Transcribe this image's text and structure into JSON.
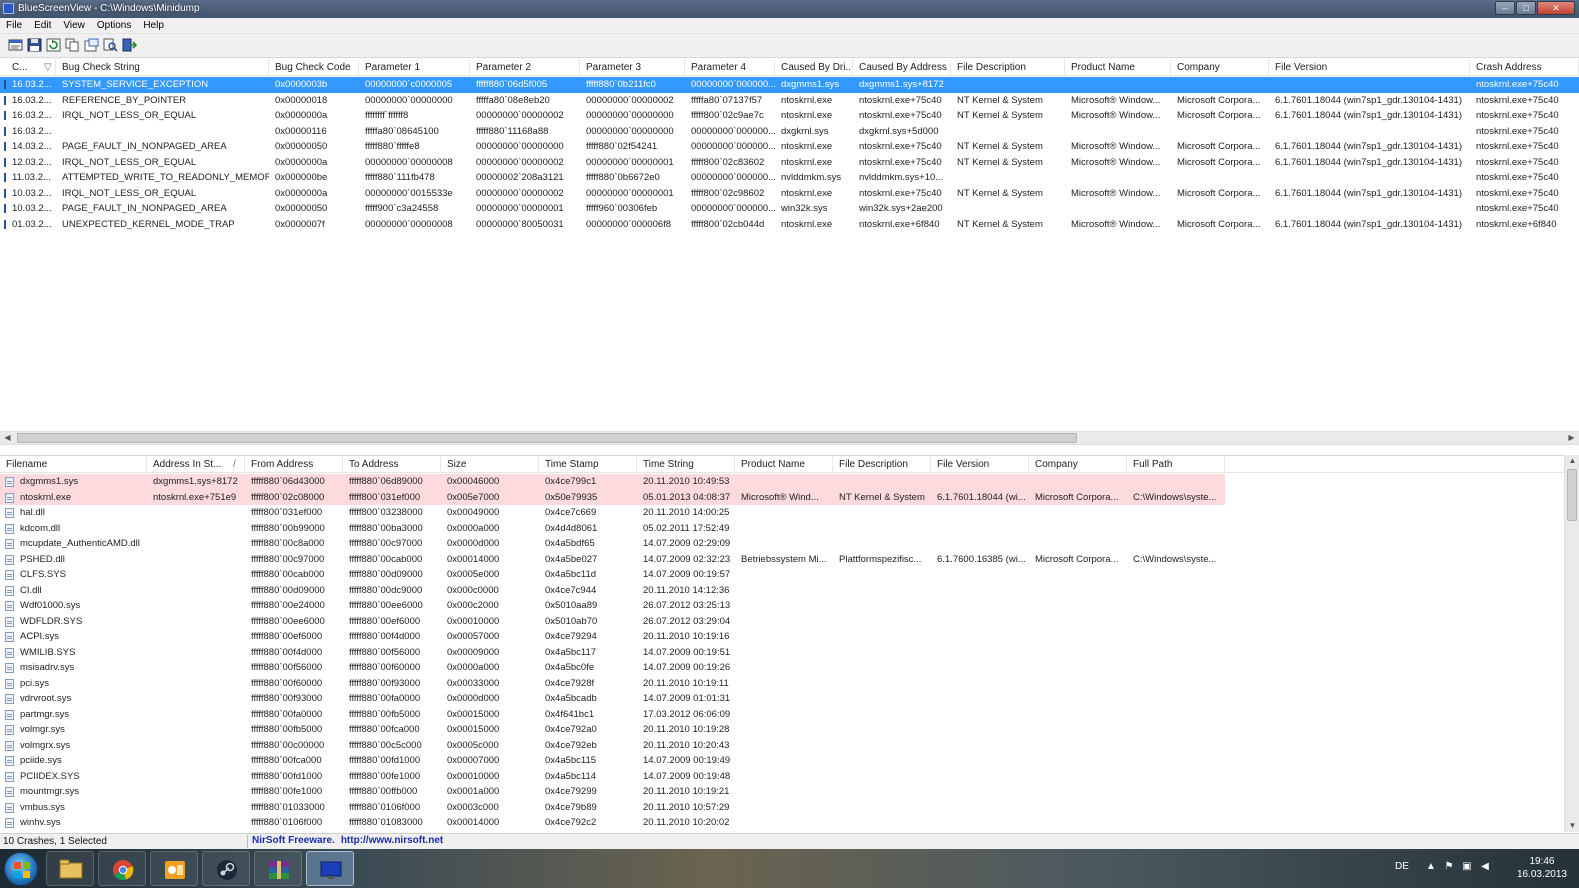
{
  "window": {
    "title": "BlueScreenView  -  C:\\Windows\\Minidump",
    "minimize": "–",
    "maximize": "□",
    "close": "✕"
  },
  "menu": [
    "File",
    "Edit",
    "View",
    "Options",
    "Help"
  ],
  "toolbar": {
    "icons": [
      "properties-icon",
      "save-icon",
      "refresh-icon",
      "copy-icon",
      "html-report-icon",
      "find-icon",
      "exit-icon"
    ]
  },
  "crash_list": {
    "columns": [
      "C...",
      "Bug Check String",
      "Bug Check Code",
      "Parameter 1",
      "Parameter 2",
      "Parameter 3",
      "Parameter 4",
      "Caused By Dri...",
      "Caused By Address",
      "File Description",
      "Product Name",
      "Company",
      "File Version",
      "Crash Address"
    ],
    "sort_indicator": "▽",
    "rows": [
      [
        "16.03.2...",
        "SYSTEM_SERVICE_EXCEPTION",
        "0x0000003b",
        "00000000`c0000005",
        "fffff880`06d5f005",
        "fffff880`0b211fc0",
        "00000000`000000...",
        "dxgmms1.sys",
        "dxgmms1.sys+8172",
        "",
        "",
        "",
        "",
        "ntoskrnl.exe+75c40"
      ],
      [
        "16.03.2...",
        "REFERENCE_BY_POINTER",
        "0x00000018",
        "00000000`00000000",
        "fffffa80`08e8eb20",
        "00000000`00000002",
        "fffffa80`07137f57",
        "ntoskrnl.exe",
        "ntoskrnl.exe+75c40",
        "NT Kernel & System",
        "Microsoft® Window...",
        "Microsoft Corpora...",
        "6.1.7601.18044 (win7sp1_gdr.130104-1431)",
        "ntoskrnl.exe+75c40"
      ],
      [
        "16.03.2...",
        "IRQL_NOT_LESS_OR_EQUAL",
        "0x0000000a",
        "ffffffff`ffffff8",
        "00000000`00000002",
        "00000000`00000000",
        "fffff800`02c9ae7c",
        "ntoskrnl.exe",
        "ntoskrnl.exe+75c40",
        "NT Kernel & System",
        "Microsoft® Window...",
        "Microsoft Corpora...",
        "6.1.7601.18044 (win7sp1_gdr.130104-1431)",
        "ntoskrnl.exe+75c40"
      ],
      [
        "16.03.2...",
        "",
        "0x00000116",
        "fffffa80`08645100",
        "fffff880`11168a88",
        "00000000`00000000",
        "00000000`000000...",
        "dxgkrnl.sys",
        "dxgkrnl.sys+5d000",
        "",
        "",
        "",
        "",
        "ntoskrnl.exe+75c40"
      ],
      [
        "14.03.2...",
        "PAGE_FAULT_IN_NONPAGED_AREA",
        "0x00000050",
        "fffff880`fffffe8",
        "00000000`00000000",
        "fffff880`02f54241",
        "00000000`000000...",
        "ntoskrnl.exe",
        "ntoskrnl.exe+75c40",
        "NT Kernel & System",
        "Microsoft® Window...",
        "Microsoft Corpora...",
        "6.1.7601.18044 (win7sp1_gdr.130104-1431)",
        "ntoskrnl.exe+75c40"
      ],
      [
        "12.03.2...",
        "IRQL_NOT_LESS_OR_EQUAL",
        "0x0000000a",
        "00000000`00000008",
        "00000000`00000002",
        "00000000`00000001",
        "fffff800`02c83602",
        "ntoskrnl.exe",
        "ntoskrnl.exe+75c40",
        "NT Kernel & System",
        "Microsoft® Window...",
        "Microsoft Corpora...",
        "6.1.7601.18044 (win7sp1_gdr.130104-1431)",
        "ntoskrnl.exe+75c40"
      ],
      [
        "11.03.2...",
        "ATTEMPTED_WRITE_TO_READONLY_MEMORY",
        "0x000000be",
        "fffff880`111fb478",
        "00000002`208a3121",
        "fffff880`0b6672e0",
        "00000000`000000...",
        "nvlddmkm.sys",
        "nvlddmkm.sys+10...",
        "",
        "",
        "",
        "",
        "ntoskrnl.exe+75c40"
      ],
      [
        "10.03.2...",
        "IRQL_NOT_LESS_OR_EQUAL",
        "0x0000000a",
        "00000000`0015533e",
        "00000000`00000002",
        "00000000`00000001",
        "fffff800`02c98602",
        "ntoskrnl.exe",
        "ntoskrnl.exe+75c40",
        "NT Kernel & System",
        "Microsoft® Window...",
        "Microsoft Corpora...",
        "6.1.7601.18044 (win7sp1_gdr.130104-1431)",
        "ntoskrnl.exe+75c40"
      ],
      [
        "10.03.2...",
        "PAGE_FAULT_IN_NONPAGED_AREA",
        "0x00000050",
        "fffff900`c3a24558",
        "00000000`00000001",
        "fffff960`00306feb",
        "00000000`000000...",
        "win32k.sys",
        "win32k.sys+2ae200",
        "",
        "",
        "",
        "",
        "ntoskrnl.exe+75c40"
      ],
      [
        "01.03.2...",
        "UNEXPECTED_KERNEL_MODE_TRAP",
        "0x0000007f",
        "00000000`00000008",
        "00000000`80050031",
        "00000000`000006f8",
        "fffff800`02cb044d",
        "ntoskrnl.exe",
        "ntoskrnl.exe+6f840",
        "NT Kernel & System",
        "Microsoft® Window...",
        "Microsoft Corpora...",
        "6.1.7601.18044 (win7sp1_gdr.130104-1431)",
        "ntoskrnl.exe+6f840"
      ]
    ],
    "selected_row": 0
  },
  "driver_list": {
    "columns": [
      "Filename",
      "Address In St...",
      "From Address",
      "To Address",
      "Size",
      "Time Stamp",
      "Time String",
      "Product Name",
      "File Description",
      "File Version",
      "Company",
      "Full Path"
    ],
    "sort_indicator": "/",
    "rows": [
      [
        "dxgmms1.sys",
        "dxgmms1.sys+8172",
        "fffff880`06d43000",
        "fffff880`06d89000",
        "0x00046000",
        "0x4ce799c1",
        "20.11.2010 10:49:53",
        "",
        "",
        "",
        "",
        ""
      ],
      [
        "ntoskrnl.exe",
        "ntoskrnl.exe+751e9",
        "fffff800`02c08000",
        "fffff800`031ef000",
        "0x005e7000",
        "0x50e79935",
        "05.01.2013 04:08:37",
        "Microsoft® Wind...",
        "NT Kernel & System",
        "6.1.7601.18044 (wi...",
        "Microsoft Corpora...",
        "C:\\Windows\\syste..."
      ],
      [
        "hal.dll",
        "",
        "fffff800`031ef000",
        "fffff800`03238000",
        "0x00049000",
        "0x4ce7c669",
        "20.11.2010 14:00:25",
        "",
        "",
        "",
        "",
        ""
      ],
      [
        "kdcom.dll",
        "",
        "fffff880`00b99000",
        "fffff880`00ba3000",
        "0x0000a000",
        "0x4d4d8061",
        "05.02.2011 17:52:49",
        "",
        "",
        "",
        "",
        ""
      ],
      [
        "mcupdate_AuthenticAMD.dll",
        "",
        "fffff880`00c8a000",
        "fffff880`00c97000",
        "0x0000d000",
        "0x4a5bdf65",
        "14.07.2009 02:29:09",
        "",
        "",
        "",
        "",
        ""
      ],
      [
        "PSHED.dll",
        "",
        "fffff880`00c97000",
        "fffff880`00cab000",
        "0x00014000",
        "0x4a5be027",
        "14.07.2009 02:32:23",
        "Betriebssystem Mi...",
        "Plattformspezifisc...",
        "6.1.7600.16385 (wi...",
        "Microsoft Corpora...",
        "C:\\Windows\\syste..."
      ],
      [
        "CLFS.SYS",
        "",
        "fffff880`00cab000",
        "fffff880`00d09000",
        "0x0005e000",
        "0x4a5bc11d",
        "14.07.2009 00:19:57",
        "",
        "",
        "",
        "",
        ""
      ],
      [
        "CI.dll",
        "",
        "fffff880`00d09000",
        "fffff880`00dc9000",
        "0x000c0000",
        "0x4ce7c944",
        "20.11.2010 14:12:36",
        "",
        "",
        "",
        "",
        ""
      ],
      [
        "Wdf01000.sys",
        "",
        "fffff880`00e24000",
        "fffff880`00ee6000",
        "0x000c2000",
        "0x5010aa89",
        "26.07.2012 03:25:13",
        "",
        "",
        "",
        "",
        ""
      ],
      [
        "WDFLDR.SYS",
        "",
        "fffff880`00ee6000",
        "fffff880`00ef6000",
        "0x00010000",
        "0x5010ab70",
        "26.07.2012 03:29:04",
        "",
        "",
        "",
        "",
        ""
      ],
      [
        "ACPI.sys",
        "",
        "fffff880`00ef6000",
        "fffff880`00f4d000",
        "0x00057000",
        "0x4ce79294",
        "20.11.2010 10:19:16",
        "",
        "",
        "",
        "",
        ""
      ],
      [
        "WMILIB.SYS",
        "",
        "fffff880`00f4d000",
        "fffff880`00f56000",
        "0x00009000",
        "0x4a5bc117",
        "14.07.2009 00:19:51",
        "",
        "",
        "",
        "",
        ""
      ],
      [
        "msisadrv.sys",
        "",
        "fffff880`00f56000",
        "fffff880`00f60000",
        "0x0000a000",
        "0x4a5bc0fe",
        "14.07.2009 00:19:26",
        "",
        "",
        "",
        "",
        ""
      ],
      [
        "pci.sys",
        "",
        "fffff880`00f60000",
        "fffff880`00f93000",
        "0x00033000",
        "0x4ce7928f",
        "20.11.2010 10:19:11",
        "",
        "",
        "",
        "",
        ""
      ],
      [
        "vdrvroot.sys",
        "",
        "fffff880`00f93000",
        "fffff880`00fa0000",
        "0x0000d000",
        "0x4a5bcadb",
        "14.07.2009 01:01:31",
        "",
        "",
        "",
        "",
        ""
      ],
      [
        "partmgr.sys",
        "",
        "fffff880`00fa0000",
        "fffff880`00fb5000",
        "0x00015000",
        "0x4f641bc1",
        "17.03.2012 06:06:09",
        "",
        "",
        "",
        "",
        ""
      ],
      [
        "volmgr.sys",
        "",
        "fffff880`00fb5000",
        "fffff880`00fca000",
        "0x00015000",
        "0x4ce792a0",
        "20.11.2010 10:19:28",
        "",
        "",
        "",
        "",
        ""
      ],
      [
        "volmgrx.sys",
        "",
        "fffff880`00c00000",
        "fffff880`00c5c000",
        "0x0005c000",
        "0x4ce792eb",
        "20.11.2010 10:20:43",
        "",
        "",
        "",
        "",
        ""
      ],
      [
        "pciide.sys",
        "",
        "fffff880`00fca000",
        "fffff880`00fd1000",
        "0x00007000",
        "0x4a5bc115",
        "14.07.2009 00:19:49",
        "",
        "",
        "",
        "",
        ""
      ],
      [
        "PCIIDEX.SYS",
        "",
        "fffff880`00fd1000",
        "fffff880`00fe1000",
        "0x00010000",
        "0x4a5bc114",
        "14.07.2009 00:19:48",
        "",
        "",
        "",
        "",
        ""
      ],
      [
        "mountmgr.sys",
        "",
        "fffff880`00fe1000",
        "fffff880`00ffb000",
        "0x0001a000",
        "0x4ce79299",
        "20.11.2010 10:19:21",
        "",
        "",
        "",
        "",
        ""
      ],
      [
        "vmbus.sys",
        "",
        "fffff880`01033000",
        "fffff880`0106f000",
        "0x0003c000",
        "0x4ce79b89",
        "20.11.2010 10:57:29",
        "",
        "",
        "",
        "",
        ""
      ],
      [
        "winhv.sys",
        "",
        "fffff880`0106f000",
        "fffff880`01083000",
        "0x00014000",
        "0x4ce792c2",
        "20.11.2010 10:20:02",
        "",
        "",
        "",
        "",
        ""
      ]
    ],
    "highlighted_rows": [
      0,
      1
    ]
  },
  "status": {
    "summary": "10 Crashes, 1 Selected",
    "credit": "NirSoft Freeware.",
    "link": "http://www.nirsoft.net"
  },
  "taskbar": {
    "apps": [
      "explorer-icon",
      "chrome-icon",
      "outlook-icon",
      "steam-icon",
      "winrar-icon",
      "bluescreenview-icon"
    ],
    "active_app": 5,
    "language": "DE",
    "time": "19:46",
    "date": "16.03.2013"
  },
  "colors": {
    "selection": "#3399ff",
    "highlight_row": "#fcdadd",
    "link": "#1a2ea8"
  }
}
